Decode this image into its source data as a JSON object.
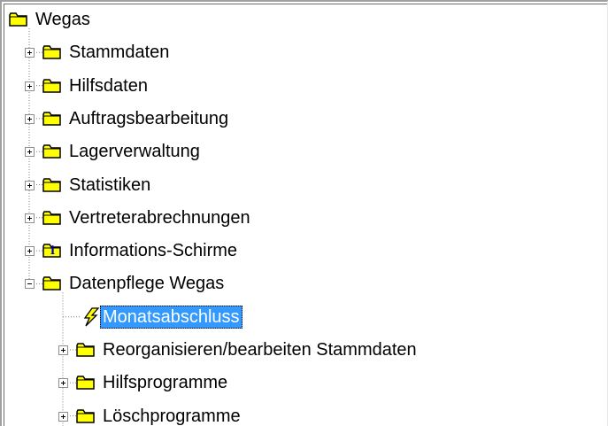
{
  "tree": {
    "root": {
      "label": "Wegas",
      "icon": "folder-icon"
    },
    "items": [
      {
        "label": "Stammdaten",
        "icon": "folder-icon",
        "expander": "plus"
      },
      {
        "label": "Hilfsdaten",
        "icon": "folder-icon",
        "expander": "plus"
      },
      {
        "label": "Auftragsbearbeitung",
        "icon": "folder-icon",
        "expander": "plus"
      },
      {
        "label": "Lagerverwaltung",
        "icon": "folder-icon",
        "expander": "plus"
      },
      {
        "label": "Statistiken",
        "icon": "folder-icon",
        "expander": "plus"
      },
      {
        "label": "Vertreterabrechnungen",
        "icon": "folder-icon",
        "expander": "plus"
      },
      {
        "label": "Informations-Schirme",
        "icon": "info-folder-icon",
        "expander": "plus"
      },
      {
        "label": "Datenpflege Wegas",
        "icon": "folder-icon",
        "expander": "minus",
        "children": [
          {
            "label": "Monatsabschluss",
            "icon": "lightning-icon",
            "selected": true
          },
          {
            "label": "Reorganisieren/bearbeiten Stammdaten",
            "icon": "folder-icon",
            "expander": "plus"
          },
          {
            "label": "Hilfsprogramme",
            "icon": "folder-icon",
            "expander": "plus"
          },
          {
            "label": "Löschprogramme",
            "icon": "folder-icon",
            "expander": "plus"
          }
        ]
      }
    ]
  },
  "colors": {
    "selection": "#3399ff",
    "folder": "#ffff00",
    "folder_outline": "#000000",
    "connector": "#808080"
  }
}
